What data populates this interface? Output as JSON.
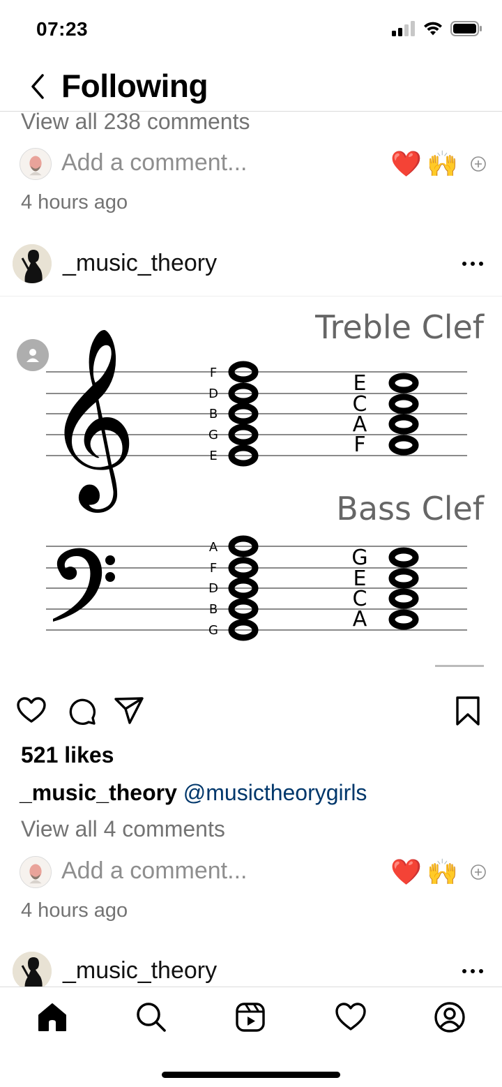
{
  "status_bar": {
    "time": "07:23"
  },
  "header": {
    "title": "Following"
  },
  "previous_post": {
    "view_all_comments": "View all 238 comments",
    "comment_placeholder": "Add a comment...",
    "emoji_heart": "❤️",
    "emoji_hands": "🙌",
    "time_ago": "4 hours ago"
  },
  "post": {
    "username": "_music_theory",
    "image": {
      "treble_title": "Treble Clef",
      "bass_title": "Bass Clef",
      "treble_line_notes": [
        "F",
        "D",
        "B",
        "G",
        "E"
      ],
      "treble_space_notes": [
        "E",
        "C",
        "A",
        "F"
      ],
      "bass_line_notes": [
        "A",
        "F",
        "D",
        "B",
        "G"
      ],
      "bass_space_notes": [
        "G",
        "E",
        "C",
        "A"
      ]
    },
    "likes": "521 likes",
    "caption_username": "_music_theory",
    "caption_mention": "@musictheorygirls",
    "view_all_comments": "View all 4 comments",
    "comment_placeholder": "Add a comment...",
    "emoji_heart": "❤️",
    "emoji_hands": "🙌",
    "time_ago": "4 hours ago"
  },
  "next_post": {
    "username": "_music_theory"
  }
}
